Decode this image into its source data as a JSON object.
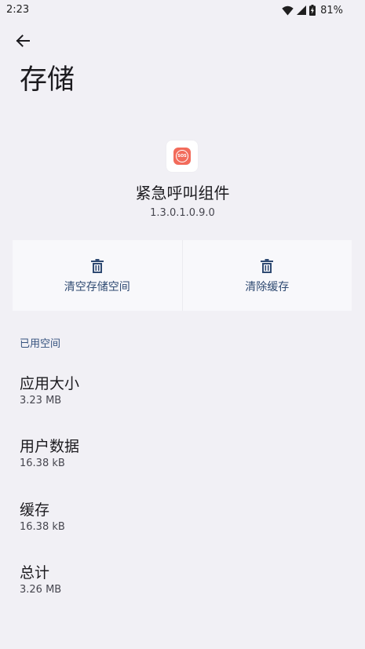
{
  "status_bar": {
    "time": "2:23",
    "battery": "81%",
    "icons": [
      "wifi-icon",
      "cell-signal-icon",
      "battery-charging-icon"
    ]
  },
  "header": {
    "back_icon": "arrow-left-icon",
    "title": "存储"
  },
  "app": {
    "icon": "sos-icon",
    "icon_text": "SOS",
    "name": "紧急呼叫组件",
    "version": "1.3.0.1.0.9.0"
  },
  "actions": {
    "clear_storage_label": "清空存储空间",
    "clear_cache_label": "清除缓存",
    "icon": "trash-icon"
  },
  "storage": {
    "section_title": "已用空间",
    "items": [
      {
        "title": "应用大小",
        "value": "3.23 MB"
      },
      {
        "title": "用户数据",
        "value": "16.38 kB"
      },
      {
        "title": "缓存",
        "value": "16.38 kB"
      },
      {
        "title": "总计",
        "value": "3.26 MB"
      }
    ]
  },
  "colors": {
    "background": "#f1f0f5",
    "accent": "#2f4a72",
    "app_icon": "#f26b5b"
  }
}
